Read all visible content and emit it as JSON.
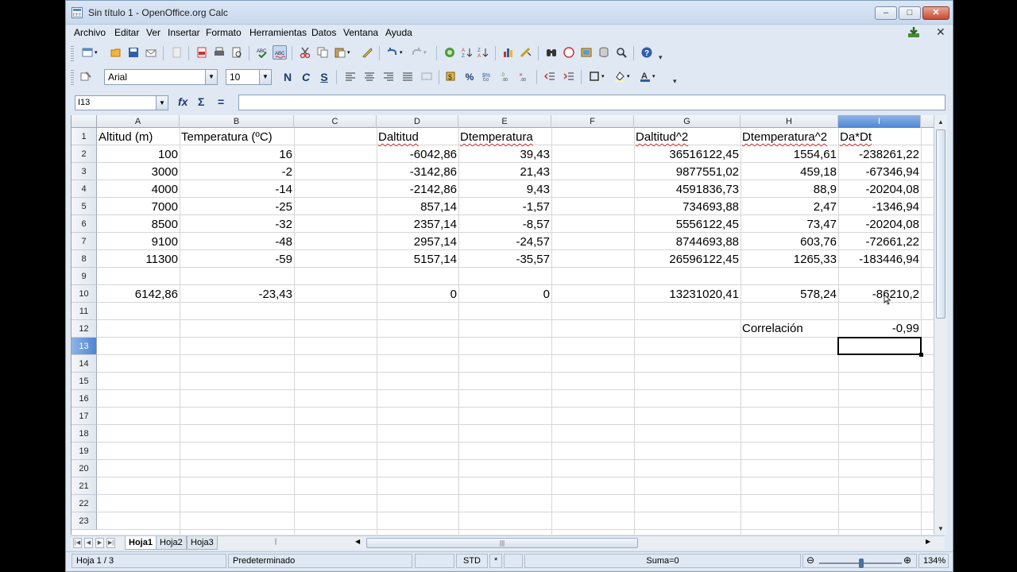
{
  "window": {
    "title": "Sin título 1 - OpenOffice.org Calc",
    "min": "–",
    "max": "□",
    "close": "✕"
  },
  "menu": [
    "Archivo",
    "Editar",
    "Ver",
    "Insertar",
    "Formato",
    "Herramientas",
    "Datos",
    "Ventana",
    "Ayuda"
  ],
  "formatting": {
    "font_name": "Arial",
    "font_size": "10",
    "bold": "N",
    "italic": "C",
    "underline": "S"
  },
  "formula_bar": {
    "name_box": "I13",
    "fx": "fx",
    "sum": "Σ",
    "equals": "=",
    "value": ""
  },
  "columns": [
    "A",
    "B",
    "C",
    "D",
    "E",
    "F",
    "G",
    "H",
    "I"
  ],
  "rows": [
    "1",
    "2",
    "3",
    "4",
    "5",
    "6",
    "7",
    "8",
    "9",
    "10",
    "11",
    "12",
    "13",
    "14",
    "15",
    "16",
    "17",
    "18",
    "19",
    "20",
    "21",
    "22",
    "23"
  ],
  "cells": {
    "A1": "Altitud (m)",
    "B1": "Temperatura (ºC)",
    "D1": "Daltitud",
    "E1": "Dtemperatura",
    "G1": "Daltitud^2",
    "H1": "Dtemperatura^2",
    "I1": "Da*Dt",
    "A2": "100",
    "B2": "16",
    "D2": "-6042,86",
    "E2": "39,43",
    "G2": "36516122,45",
    "H2": "1554,61",
    "I2": "-238261,22",
    "A3": "3000",
    "B3": "-2",
    "D3": "-3142,86",
    "E3": "21,43",
    "G3": "9877551,02",
    "H3": "459,18",
    "I3": "-67346,94",
    "A4": "4000",
    "B4": "-14",
    "D4": "-2142,86",
    "E4": "9,43",
    "G4": "4591836,73",
    "H4": "88,9",
    "I4": "-20204,08",
    "A5": "7000",
    "B5": "-25",
    "D5": "857,14",
    "E5": "-1,57",
    "G5": "734693,88",
    "H5": "2,47",
    "I5": "-1346,94",
    "A6": "8500",
    "B6": "-32",
    "D6": "2357,14",
    "E6": "-8,57",
    "G6": "5556122,45",
    "H6": "73,47",
    "I6": "-20204,08",
    "A7": "9100",
    "B7": "-48",
    "D7": "2957,14",
    "E7": "-24,57",
    "G7": "8744693,88",
    "H7": "603,76",
    "I7": "-72661,22",
    "A8": "11300",
    "B8": "-59",
    "D8": "5157,14",
    "E8": "-35,57",
    "G8": "26596122,45",
    "H8": "1265,33",
    "I8": "-183446,94",
    "A10": "6142,86",
    "B10": "-23,43",
    "D10": "0",
    "E10": "0",
    "G10": "13231020,41",
    "H10": "578,24",
    "I10": "-86210,2",
    "H12": "Correlación",
    "I12": "-0,99"
  },
  "sheet_tabs": [
    "Hoja1",
    "Hoja2",
    "Hoja3"
  ],
  "status": {
    "sheet": "Hoja 1 / 3",
    "style": "Predeterminado",
    "mode": "STD",
    "modified": "*",
    "sum": "Suma=0",
    "zoom": "134%"
  }
}
